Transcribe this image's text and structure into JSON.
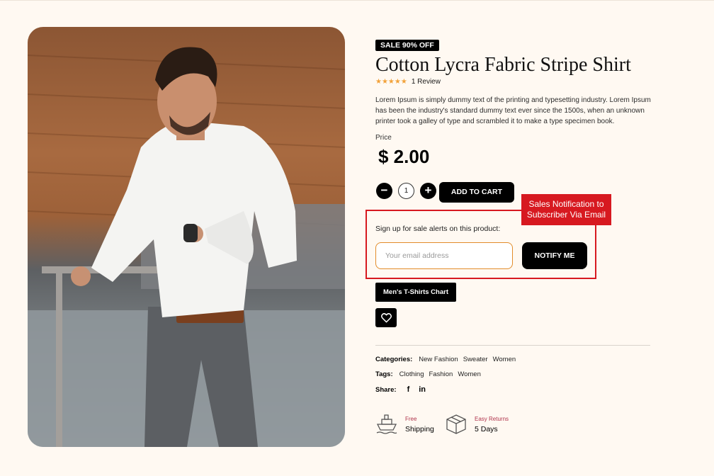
{
  "product": {
    "badge": "SALE 90% OFF",
    "title": "Cotton Lycra Fabric Stripe Shirt",
    "rating_stars": 5,
    "review_text": "1 Review",
    "description": "Lorem Ipsum is simply dummy text of the printing and typesetting industry. Lorem Ipsum has been the industry's standard dummy text ever since the 1500s, when an unknown printer took a galley of type and scrambled it to make a type specimen book.",
    "price_label": "Price",
    "price": "$ 2.00"
  },
  "cart": {
    "minus_icon": "minus-icon",
    "plus_icon": "plus-icon",
    "quantity": "1",
    "add_to_cart_label": "ADD TO CART"
  },
  "notify": {
    "callout_line1": "Sales Notification to",
    "callout_line2": "Subscriber Via Email",
    "prompt": "Sign up for sale alerts on this product:",
    "email_placeholder": "Your email address",
    "email_value": "",
    "button_label": "NOTIFY ME"
  },
  "size_chart_label": "Men's T-Shirts Chart",
  "wishlist_icon": "heart-icon",
  "meta": {
    "categories_label": "Categories:",
    "categories": [
      "New Fashion",
      "Sweater",
      "Women"
    ],
    "tags_label": "Tags:",
    "tags": [
      "Clothing",
      "Fashion",
      "Women"
    ],
    "share_label": "Share:",
    "share_icons": [
      "facebook-icon",
      "linkedin-icon"
    ]
  },
  "features": [
    {
      "icon": "ship-icon",
      "small": "Free",
      "big": "Shipping"
    },
    {
      "icon": "box-icon",
      "small": "Easy Returns",
      "big": "5 Days"
    }
  ],
  "colors": {
    "background": "#fff9f2",
    "highlight_red": "#d71920",
    "star_orange": "#f2a23a",
    "input_border": "#e28c2a",
    "feature_accent": "#b0344c"
  }
}
